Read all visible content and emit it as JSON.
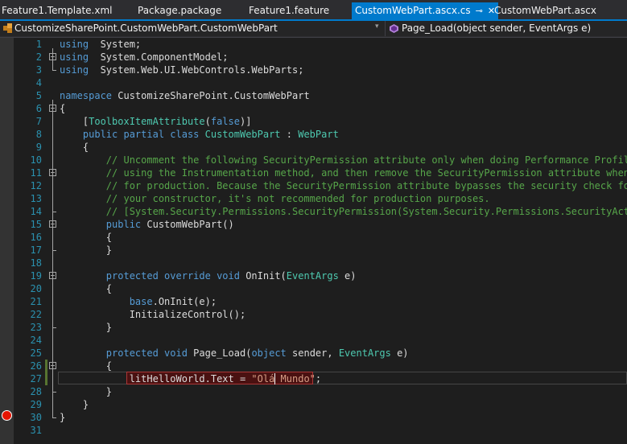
{
  "tabs": [
    {
      "label": "Feature1.Template.xml",
      "active": false
    },
    {
      "label": "Package.package",
      "active": false
    },
    {
      "label": "Feature1.feature",
      "active": false
    },
    {
      "label": "CustomWebPart.ascx.cs",
      "active": true,
      "pin": "⊸",
      "close": "✕"
    },
    {
      "label": "CustomWebPart.ascx",
      "active": false
    }
  ],
  "nav": {
    "type_selector": "CustomizeSharePoint.CustomWebPart.CustomWebPart",
    "member_selector": "Page_Load(object sender, EventArgs e)",
    "dropdown_glyph": "▾"
  },
  "colors": {
    "accent": "#007acc",
    "keyword": "#569cd6",
    "type": "#4ec9b0",
    "comment": "#57a64a",
    "string": "#d69d85",
    "linenumber": "#2b91af",
    "breakpoint": "#e51400"
  },
  "editor": {
    "lines": [
      {
        "n": "1",
        "t": [
          [
            "kw",
            "using"
          ],
          [
            "",
            "  System;"
          ]
        ]
      },
      {
        "n": "2",
        "t": [
          [
            "kw",
            "using"
          ],
          [
            "",
            "  System.ComponentModel;"
          ]
        ]
      },
      {
        "n": "3",
        "t": [
          [
            "kw",
            "using"
          ],
          [
            "",
            "  System.Web.UI.WebControls.WebParts;"
          ]
        ]
      },
      {
        "n": "4",
        "t": []
      },
      {
        "n": "5",
        "t": [
          [
            "kw",
            "namespace"
          ],
          [
            "",
            " CustomizeSharePoint.CustomWebPart"
          ]
        ]
      },
      {
        "n": "6",
        "t": [
          [
            "",
            "{"
          ]
        ]
      },
      {
        "n": "7",
        "t": [
          [
            "",
            "    ["
          ],
          [
            "ty",
            "ToolboxItemAttribute"
          ],
          [
            "",
            "("
          ],
          [
            "kw",
            "false"
          ],
          [
            "",
            ")]"
          ]
        ]
      },
      {
        "n": "8",
        "t": [
          [
            "kw",
            "    public partial class"
          ],
          [
            "",
            ""
          ],
          [
            "ty",
            " CustomWebPart"
          ],
          [
            "",
            " : "
          ],
          [
            "ty",
            "WebPart"
          ]
        ]
      },
      {
        "n": "9",
        "t": [
          [
            "",
            "    {"
          ]
        ]
      },
      {
        "n": "10",
        "t": [
          [
            "cm",
            "        // Uncomment the following SecurityPermission attribute only when doing Performance Profiling"
          ]
        ]
      },
      {
        "n": "11",
        "t": [
          [
            "cm",
            "        // using the Instrumentation method, and then remove the SecurityPermission attribute when th"
          ]
        ]
      },
      {
        "n": "12",
        "t": [
          [
            "cm",
            "        // for production. Because the SecurityPermission attribute bypasses the security check for c"
          ]
        ]
      },
      {
        "n": "13",
        "t": [
          [
            "cm",
            "        // your constructor, it's not recommended for production purposes."
          ]
        ]
      },
      {
        "n": "14",
        "t": [
          [
            "cm",
            "        // [System.Security.Permissions.SecurityPermission(System.Security.Permissions.SecurityAction"
          ]
        ]
      },
      {
        "n": "15",
        "t": [
          [
            "kw",
            "        public"
          ],
          [
            "",
            " CustomWebPart()"
          ]
        ]
      },
      {
        "n": "16",
        "t": [
          [
            "",
            "        {"
          ]
        ]
      },
      {
        "n": "17",
        "t": [
          [
            "",
            "        }"
          ]
        ]
      },
      {
        "n": "18",
        "t": []
      },
      {
        "n": "19",
        "t": [
          [
            "kw",
            "        protected override void"
          ],
          [
            "",
            " OnInit("
          ],
          [
            "ty",
            "EventArgs"
          ],
          [
            "",
            " e)"
          ]
        ]
      },
      {
        "n": "20",
        "t": [
          [
            "",
            "        {"
          ]
        ]
      },
      {
        "n": "21",
        "t": [
          [
            "kw",
            "            base"
          ],
          [
            "",
            ".OnInit(e);"
          ]
        ]
      },
      {
        "n": "22",
        "t": [
          [
            "",
            "            InitializeControl();"
          ]
        ]
      },
      {
        "n": "23",
        "t": [
          [
            "",
            "        }"
          ]
        ]
      },
      {
        "n": "24",
        "t": []
      },
      {
        "n": "25",
        "t": [
          [
            "kw",
            "        protected void"
          ],
          [
            "",
            " Page_Load("
          ],
          [
            "kw",
            "object"
          ],
          [
            "",
            " sender, "
          ],
          [
            "ty",
            "EventArgs"
          ],
          [
            "",
            " e)"
          ]
        ]
      },
      {
        "n": "26",
        "t": [
          [
            "",
            "        {"
          ]
        ]
      },
      {
        "n": "27",
        "t": [
          [
            "",
            "            litHelloWorld.Text = "
          ],
          [
            "st",
            "\"Olá Mundo\""
          ],
          [
            "",
            ";"
          ]
        ]
      },
      {
        "n": "28",
        "t": [
          [
            "",
            "        }"
          ]
        ]
      },
      {
        "n": "29",
        "t": [
          [
            "",
            "    }"
          ]
        ]
      },
      {
        "n": "30",
        "t": [
          [
            "",
            "}"
          ]
        ]
      },
      {
        "n": "31",
        "t": []
      }
    ]
  }
}
